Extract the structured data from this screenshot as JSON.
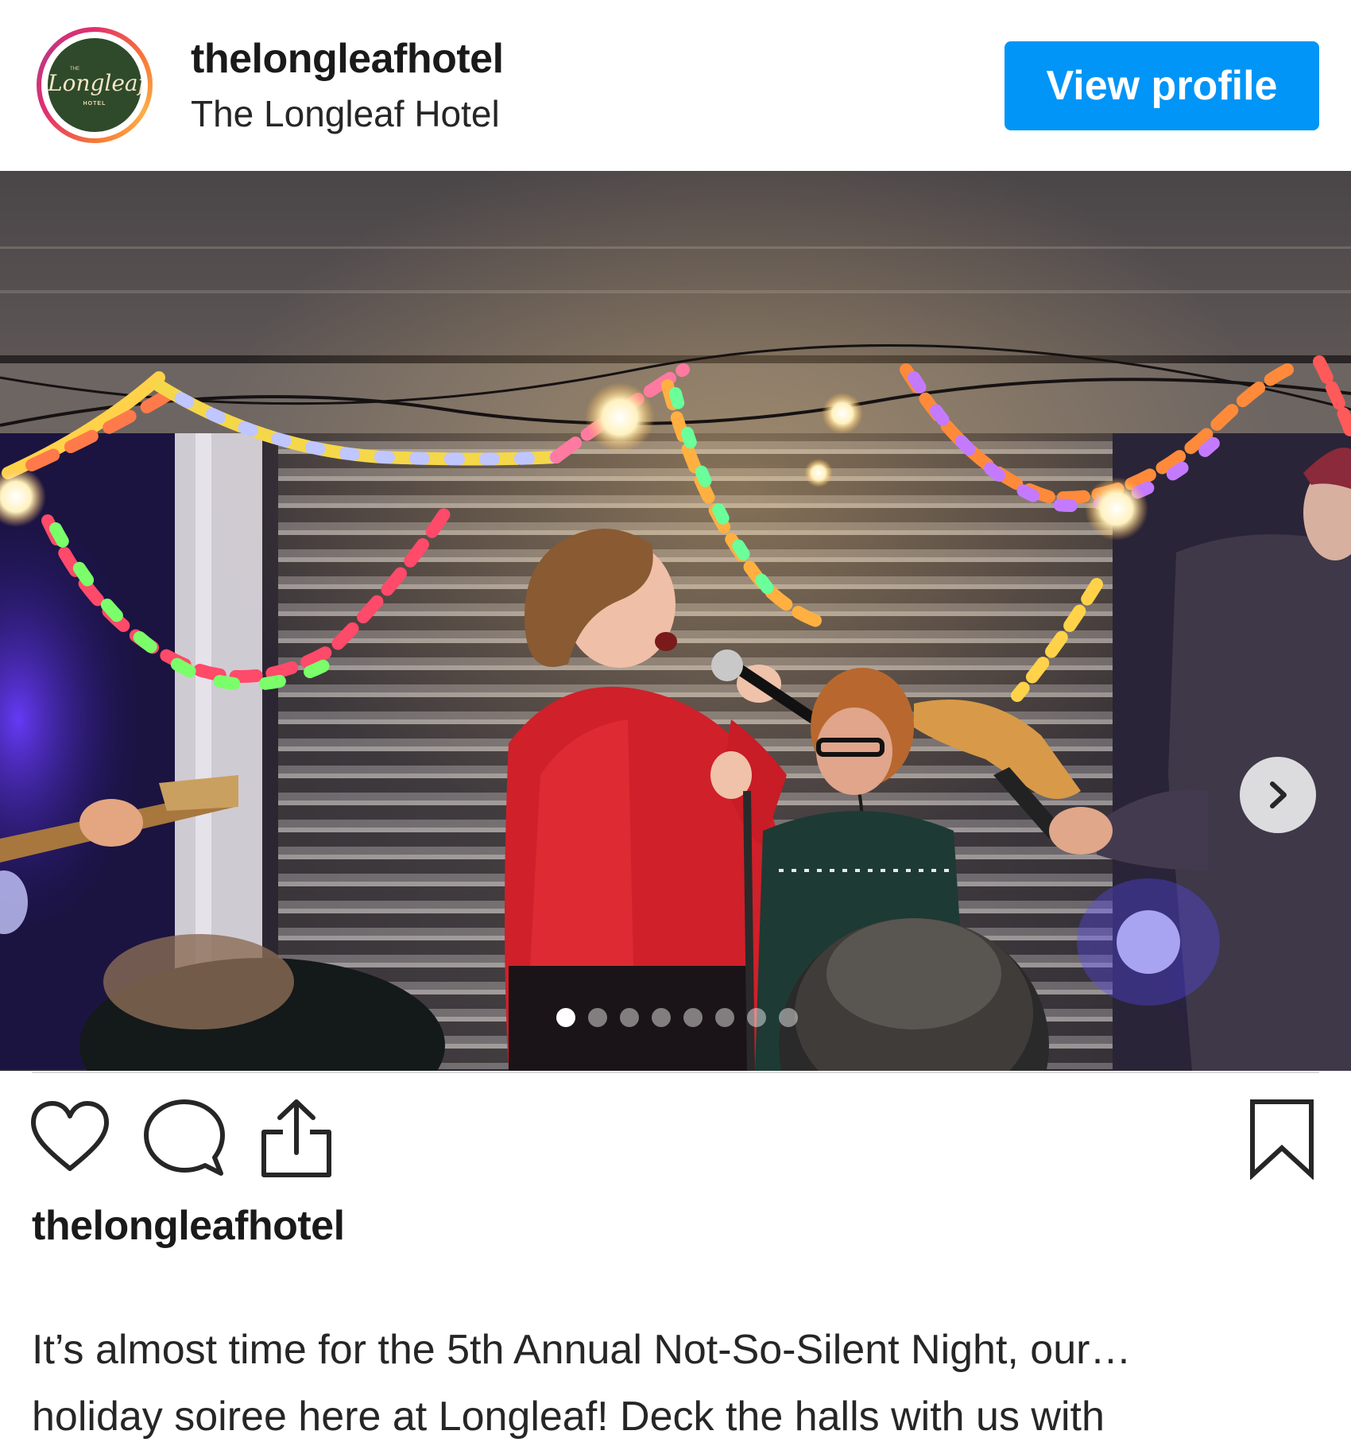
{
  "header": {
    "avatar_text": {
      "small_top": "THE",
      "script": "Longleaf",
      "small_bottom": "HOTEL"
    },
    "username": "thelongleafhotel",
    "display_name": "The Longleaf Hotel",
    "view_profile_label": "View profile",
    "view_profile_color": "#0095f6"
  },
  "carousel": {
    "photo_description_icon": "concert-photo",
    "slide_count": 8,
    "active_slide": 1,
    "next_icon": "chevron-right-icon"
  },
  "actions": {
    "like_icon": "heart-icon",
    "comment_icon": "comment-bubble-icon",
    "share_icon": "share-upload-icon",
    "save_icon": "bookmark-icon"
  },
  "caption": {
    "username": "thelongleafhotel",
    "line1": "It’s almost time for the 5th Annual Not-So-Silent Night, our…",
    "line2": "holiday soiree here at Longleaf! Deck the halls with us with"
  }
}
